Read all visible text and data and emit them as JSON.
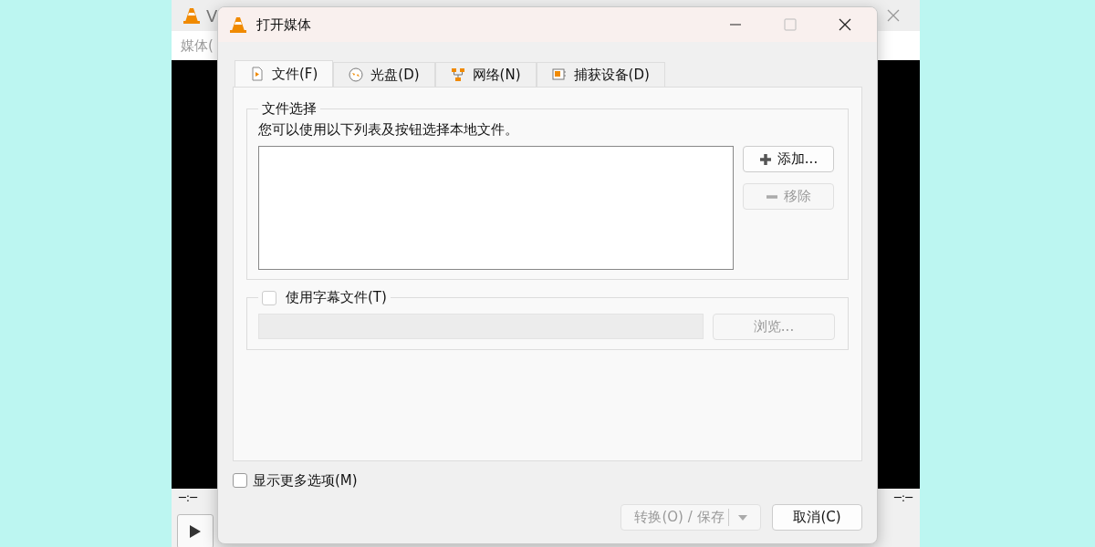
{
  "background_window": {
    "title": "V",
    "menu": "媒体(",
    "time_left": "─:─",
    "time_right": "─:─"
  },
  "dialog": {
    "title": "打开媒体",
    "tabs": [
      {
        "label": "文件(F)",
        "kind": "file",
        "selected": true
      },
      {
        "label": "光盘(D)",
        "kind": "disc",
        "selected": false
      },
      {
        "label": "网络(N)",
        "kind": "network",
        "selected": false
      },
      {
        "label": "捕获设备(D)",
        "kind": "capture",
        "selected": false
      }
    ],
    "file_group": {
      "title": "文件选择",
      "hint": "您可以使用以下列表及按钮选择本地文件。",
      "buttons": [
        {
          "label": "添加...",
          "kind": "plus",
          "disabled": false
        },
        {
          "label": "移除",
          "kind": "minus",
          "disabled": true
        }
      ]
    },
    "subtitle_group": {
      "label": "使用字幕文件(T)",
      "checked": false,
      "browse": {
        "label": "浏览...",
        "disabled": true
      }
    },
    "more_options": {
      "label": "显示更多选项(M)",
      "checked": false
    },
    "convert_button": {
      "label": "转换(O) / 保存",
      "disabled": true
    },
    "cancel_button": {
      "label": "取消(C)",
      "disabled": false
    }
  }
}
